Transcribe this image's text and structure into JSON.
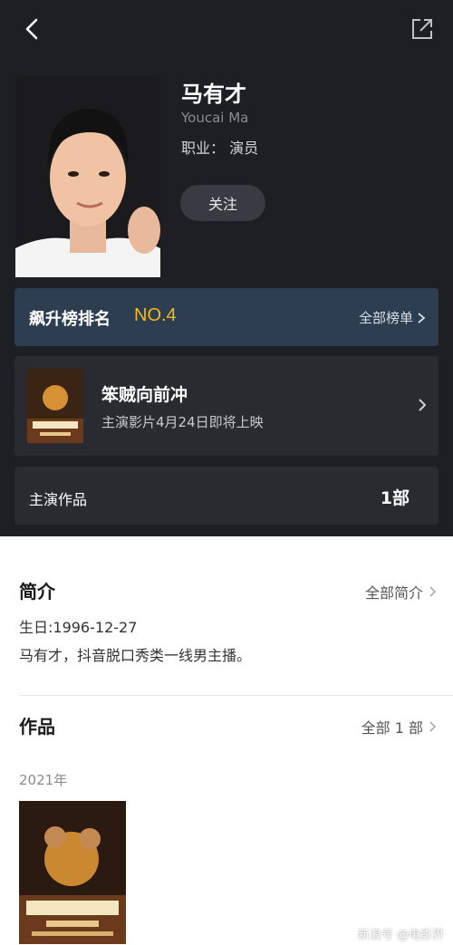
{
  "header": {
    "back_icon": "chevron-left-icon",
    "share_icon": "external-share-icon"
  },
  "profile": {
    "name": "马有才",
    "name_en": "Youcai Ma",
    "occupation": "职业： 演员",
    "follow_label": "关注"
  },
  "rank": {
    "label": "飙升榜排名",
    "value": "NO.4",
    "all_label": "全部榜单",
    "accent_color": "#f5b81d",
    "card_color": "#2d3e50"
  },
  "featured_movie": {
    "title": "笨贼向前冲",
    "subtitle": "主演影片4月24日即将上映"
  },
  "works_summary": {
    "label": "主演作品",
    "count": "1部"
  },
  "intro": {
    "title": "简介",
    "more_label": "全部简介",
    "birthday": "生日:1996-12-27",
    "description": "马有才，抖音脱口秀类一线男主播。"
  },
  "works": {
    "title": "作品",
    "more_label": "全部 1 部",
    "year": "2021年"
  },
  "watermark": "新浪号 @电影界"
}
